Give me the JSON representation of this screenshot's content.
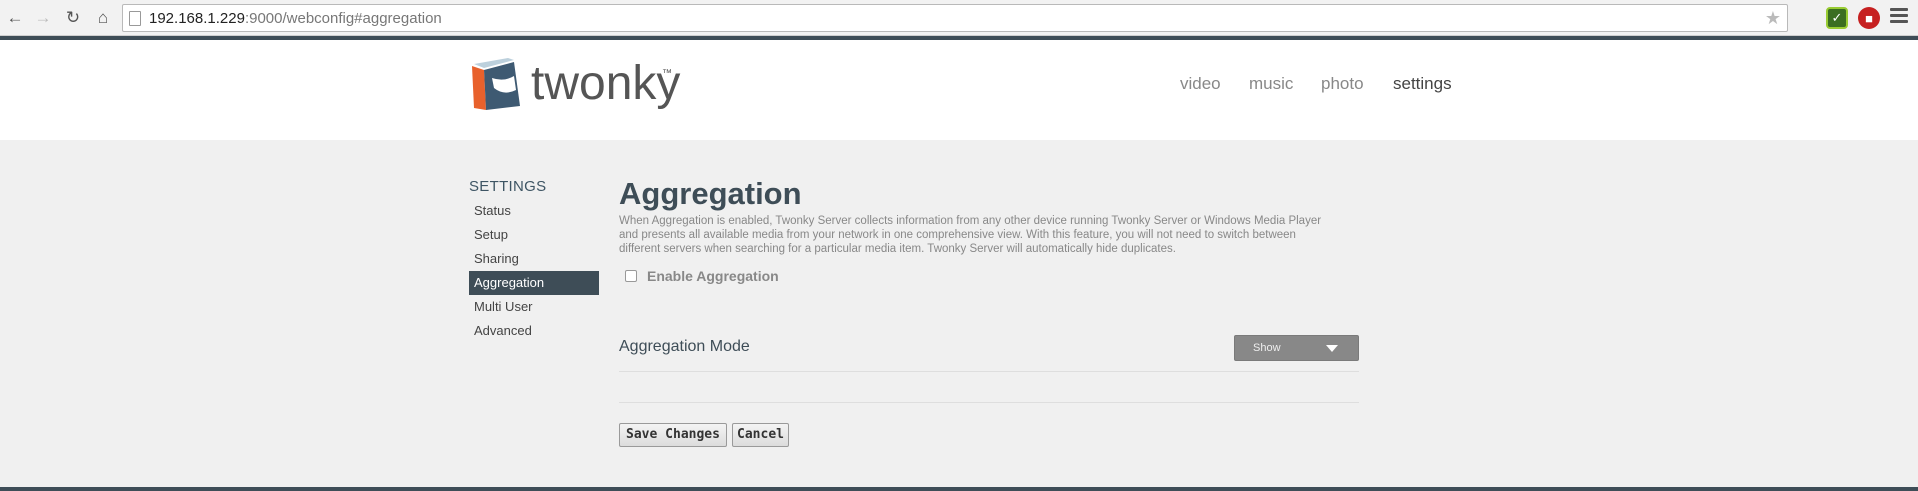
{
  "browser": {
    "url_host": "192.168.1.229",
    "url_rest": ":9000/webconfig#aggregation"
  },
  "brand": {
    "logo_text": "twonky",
    "logo_tm": "™",
    "accent_orange": "#e8612c",
    "accent_blue": "#3e5a72",
    "header_dark": "#3e4d57"
  },
  "mainnav": [
    {
      "label": "video"
    },
    {
      "label": "music"
    },
    {
      "label": "photo"
    },
    {
      "label": "settings"
    }
  ],
  "sidebar": {
    "title": "SETTINGS",
    "items": [
      {
        "label": "Status"
      },
      {
        "label": "Setup"
      },
      {
        "label": "Sharing"
      },
      {
        "label": "Aggregation"
      },
      {
        "label": "Multi User"
      },
      {
        "label": "Advanced"
      }
    ],
    "active": "Aggregation"
  },
  "main": {
    "title": "Aggregation",
    "description": "When Aggregation is enabled, Twonky Server collects information from any other device running Twonky Server or Windows Media Player and presents all available media from your network in one comprehensive view. With this feature, you will not need to switch between different servers when searching for a particular media item. Twonky Server will automatically hide duplicates.",
    "enable_label": "Enable Aggregation",
    "enable_checked": false,
    "mode_label": "Aggregation Mode",
    "mode_value": "Show",
    "save_label": "Save Changes",
    "cancel_label": "Cancel"
  }
}
